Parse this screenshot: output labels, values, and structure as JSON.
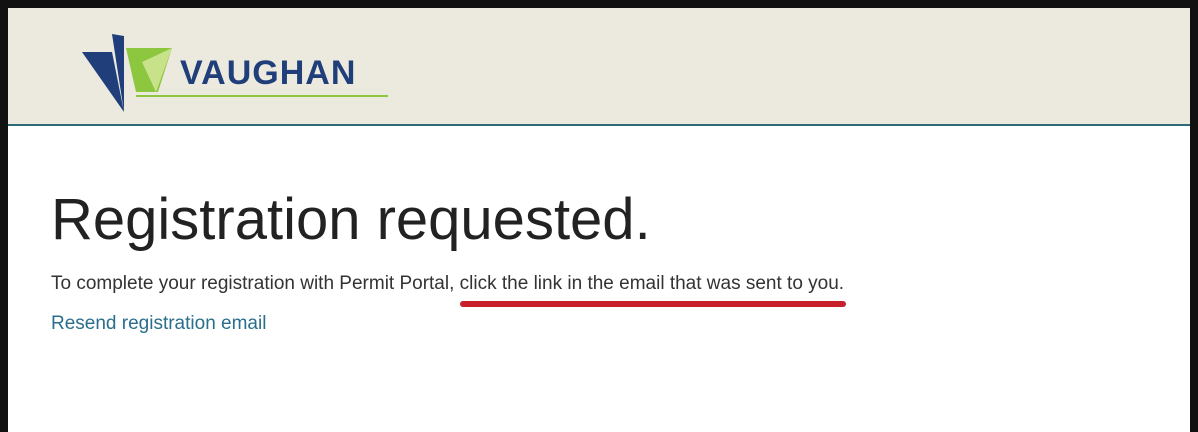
{
  "header": {
    "logo_text": "VAUGHAN",
    "colors": {
      "background": "#ece9de",
      "divider": "#2d6a78",
      "logo_navy": "#1f3e7a",
      "logo_green": "#8dc63f"
    }
  },
  "main": {
    "title": "Registration requested.",
    "message_prefix": "To complete your registration with Permit Portal, ",
    "message_highlight": "click the link in the email that was sent to you.",
    "resend_link": "Resend registration email"
  },
  "annotation": {
    "underline_color": "#c8202a"
  }
}
